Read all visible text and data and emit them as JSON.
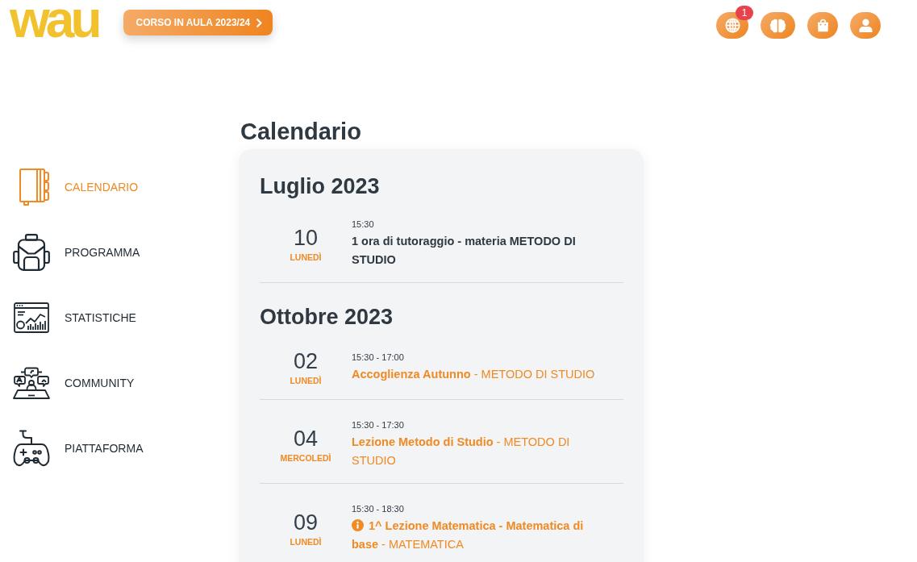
{
  "top_bar": {
    "logo": "wau",
    "course_button": "CORSO IN AULA 2023/24",
    "notification_badge": "1"
  },
  "sidebar": {
    "items": [
      {
        "label": "CALENDARIO",
        "selected": true
      },
      {
        "label": "PROGRAMMA",
        "selected": false
      },
      {
        "label": "STATISTICHE",
        "selected": false
      },
      {
        "label": "COMMUNITY",
        "selected": false
      },
      {
        "label": "PIATTAFORMA",
        "selected": false
      }
    ]
  },
  "page_title": "Calendario",
  "calendar": {
    "months": [
      {
        "title": "Luglio 2023",
        "events": [
          {
            "kind": "plain",
            "day": "10",
            "weekday": "LUNEDÌ",
            "time": "15:30",
            "title": "1 ora di tutoraggio - materia METODO DI STUDIO",
            "info": false
          }
        ]
      },
      {
        "title": "Ottobre 2023",
        "events": [
          {
            "kind": "course",
            "day": "02",
            "weekday": "LUNEDÌ",
            "time": "15:30 - 17:00",
            "title": "**Accoglienza Autunno** - METODO DI STUDIO",
            "info": false
          },
          {
            "kind": "course",
            "day": "04",
            "weekday": "MERCOLEDÌ",
            "time": "15:30 - 17:30",
            "title": "**Lezione Metodo di Studio** - METODO DI STUDIO",
            "info": false
          },
          {
            "kind": "course",
            "day": "09",
            "weekday": "LUNEDÌ",
            "time": "15:30 - 18:30",
            "title": "**1^ Lezione Matematica - Matematica di base** - MATEMATICA",
            "info": true
          }
        ]
      }
    ]
  }
}
